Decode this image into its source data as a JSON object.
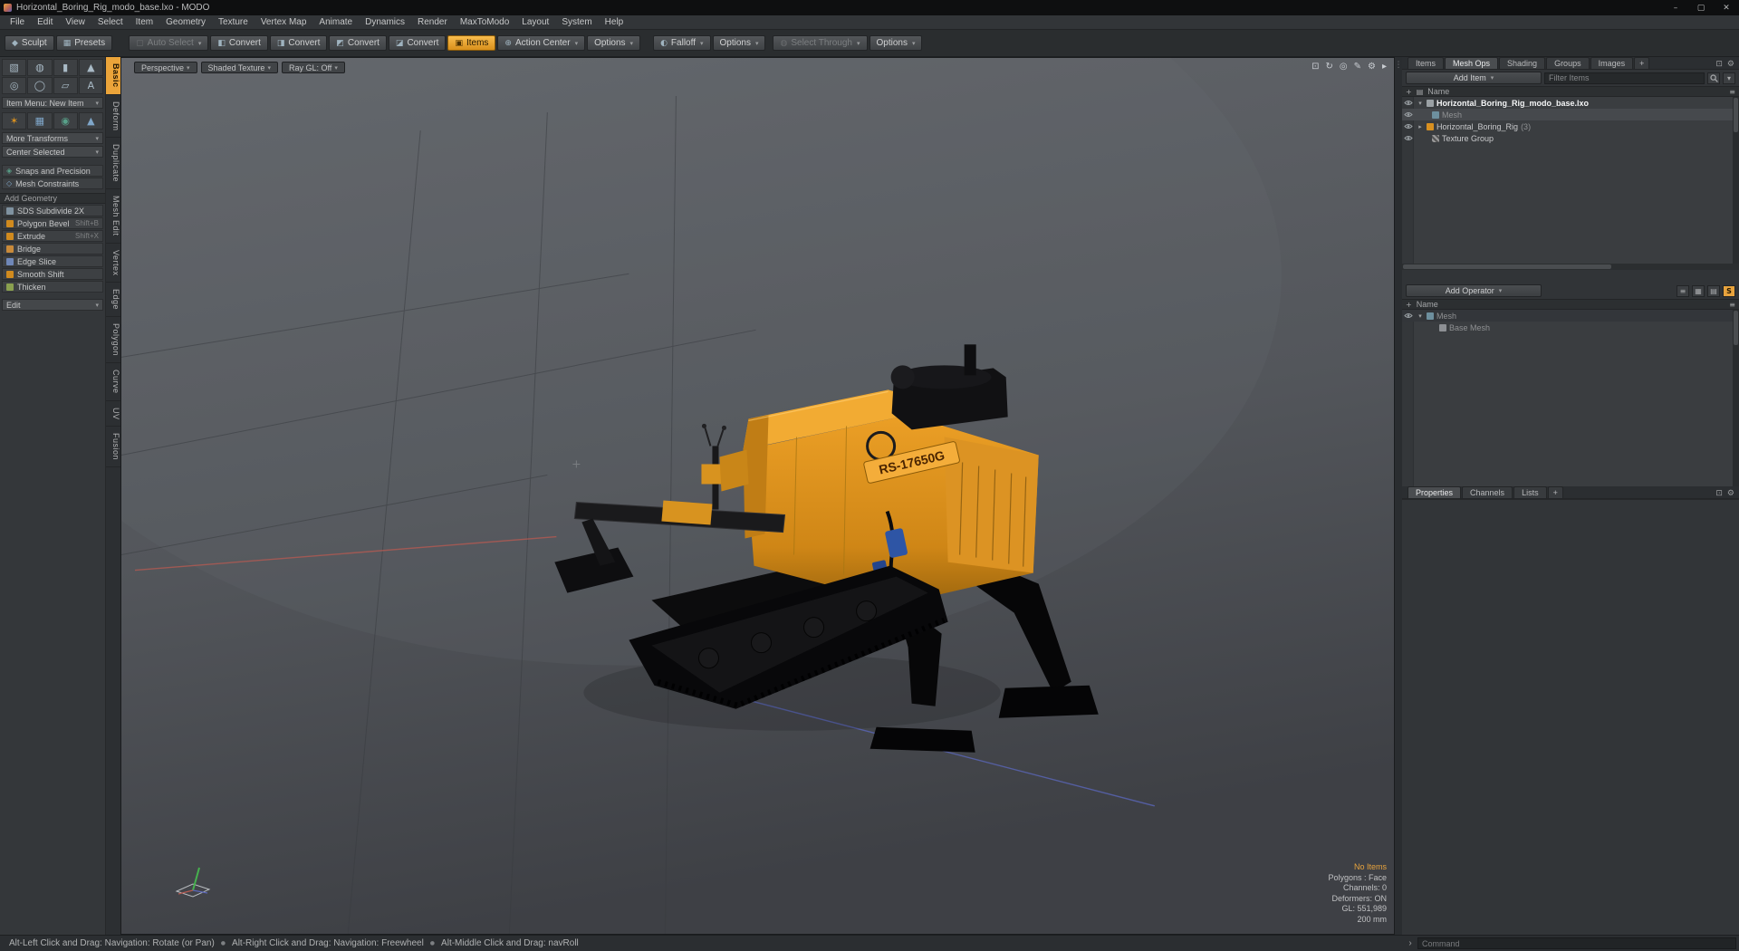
{
  "window": {
    "title": "Horizontal_Boring_Rig_modo_base.lxo - MODO"
  },
  "menu": {
    "items": [
      "File",
      "Edit",
      "View",
      "Select",
      "Item",
      "Geometry",
      "Texture",
      "Vertex Map",
      "Animate",
      "Dynamics",
      "Render",
      "MaxToModo",
      "Layout",
      "System",
      "Help"
    ]
  },
  "toolbar": {
    "buttons": [
      {
        "label": "Sculpt"
      },
      {
        "label": "Presets"
      },
      {
        "label": "Auto Select"
      },
      {
        "label": "Convert"
      },
      {
        "label": "Convert"
      },
      {
        "label": "Convert"
      },
      {
        "label": "Convert"
      },
      {
        "label": "Items"
      },
      {
        "label": "Action Center"
      },
      {
        "label": "Options"
      },
      {
        "label": "Falloff"
      },
      {
        "label": "Options"
      },
      {
        "label": "Select Through"
      },
      {
        "label": "Options"
      }
    ]
  },
  "left_panel": {
    "item_menu": "Item Menu: New Item",
    "more_transforms": "More Transforms",
    "center_selected": "Center Selected",
    "snaps_and_precision": "Snaps and Precision",
    "mesh_constraints": "Mesh Constraints",
    "add_geometry_header": "Add Geometry",
    "geometry_tools": [
      {
        "label": "SDS Subdivide 2X",
        "shortcut": ""
      },
      {
        "label": "Polygon Bevel",
        "shortcut": "Shift+B"
      },
      {
        "label": "Extrude",
        "shortcut": "Shift+X"
      },
      {
        "label": "Bridge",
        "shortcut": ""
      },
      {
        "label": "Edge Slice",
        "shortcut": ""
      },
      {
        "label": "Smooth Shift",
        "shortcut": ""
      },
      {
        "label": "Thicken",
        "shortcut": ""
      }
    ],
    "edit_dropdown": "Edit"
  },
  "tool_tabs": [
    "Basic",
    "Deform",
    "Duplicate",
    "Mesh Edit",
    "Vertex",
    "Edge",
    "Polygon",
    "Curve",
    "UV",
    "Fusion"
  ],
  "viewport": {
    "camera": "Perspective",
    "shading_mode": "Shaded Texture",
    "ray_gl": "Ray GL: Off",
    "machine_decal": "RS-17650G",
    "stats": {
      "selection": "No Items",
      "polygons": "Polygons : Face",
      "channels": "Channels: 0",
      "deformers": "Deformers: ON",
      "gl_count": "GL: 551,989",
      "grid_size": "200 mm"
    }
  },
  "item_list": {
    "tabs": [
      "Items",
      "Mesh Ops",
      "Shading",
      "Groups",
      "Images",
      "+"
    ],
    "add_item": "Add Item",
    "filter_placeholder": "Filter Items",
    "name_header": "Name",
    "rows": [
      {
        "label": "Horizontal_Boring_Rig_modo_base.lxo"
      },
      {
        "label": "Mesh"
      },
      {
        "label": "Horizontal_Boring_Rig",
        "suffix": "(3)"
      },
      {
        "label": "Texture Group"
      }
    ]
  },
  "mesh_ops": {
    "add_operator": "Add Operator",
    "name_header": "Name",
    "rows": [
      {
        "label": "Mesh"
      },
      {
        "label": "Base Mesh"
      }
    ]
  },
  "properties_tabs": [
    "Properties",
    "Channels",
    "Lists",
    "+"
  ],
  "command_bar": {
    "prompt": "›",
    "placeholder": "Command"
  },
  "statusbar": {
    "hints": [
      "Alt-Left Click and Drag: Navigation: Rotate (or Pan)",
      "Alt-Right Click and Drag: Navigation: Freewheel",
      "Alt-Middle Click and Drag: navRoll"
    ]
  },
  "colors": {
    "accent_orange": "#e8a33d",
    "decal_orange": "#f4ad3a",
    "viewport_top": "#63666b",
    "viewport_bottom": "#3f4145",
    "axis_red": "#b35a52",
    "axis_blue": "#5a66b8",
    "axis_green": "#46b14e"
  },
  "icons": {
    "minimize": "–",
    "maximize": "▢",
    "close": "✕",
    "dropdown": "▾",
    "disclosure_open": "▾",
    "disclosure_closed": "▸",
    "sculpt": "◆",
    "presets": "▦",
    "auto_select": "▢",
    "convert_a": "◧",
    "convert_b": "◨",
    "convert_c": "◩",
    "convert_d": "◪",
    "items": "▣",
    "action_center": "⊕",
    "falloff": "◐",
    "select_through": "◍",
    "snaps": "◈",
    "constraints": "◇",
    "cube": "▧",
    "sphere": "◍",
    "cylinder": "▮",
    "cone": "▲",
    "torus": "◎",
    "capsule": "◯",
    "plane": "▱",
    "text": "A",
    "splat": "✶",
    "grid2": "▦",
    "globe": "◉",
    "terrain": "▲",
    "fit": "⊡",
    "rotate": "↻",
    "zoom": "◎",
    "pencil": "✎",
    "gear": "⚙",
    "more": "▸",
    "grip": "⋮",
    "plus": "+",
    "rows": "▤",
    "list": "≡",
    "grid": "▦",
    "solo": "S",
    "pin": "⊡",
    "bullet": "●"
  }
}
